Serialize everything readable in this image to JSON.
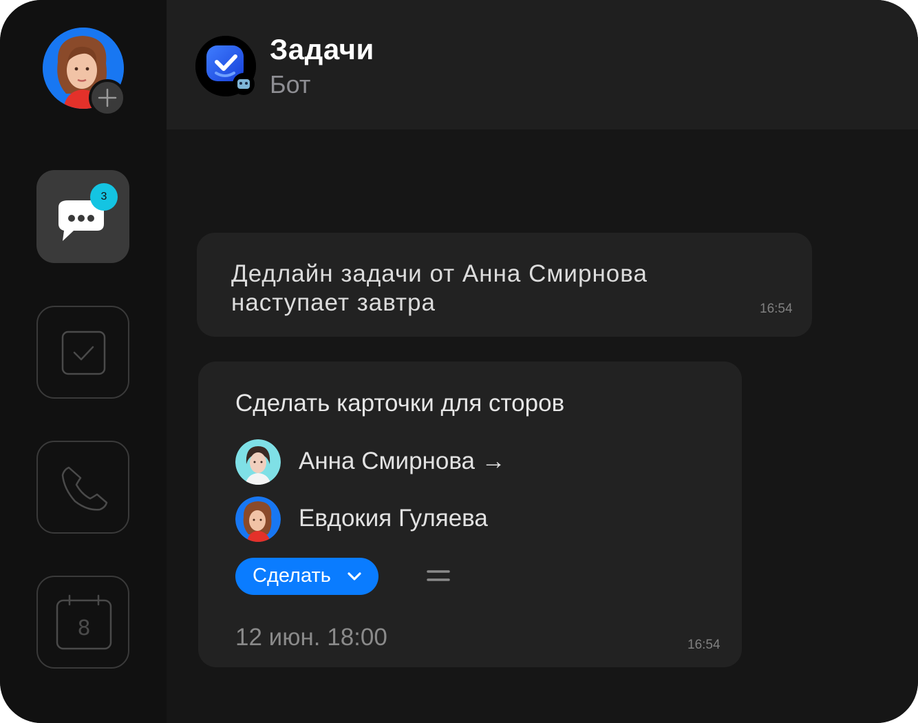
{
  "chat": {
    "title": "Задачи",
    "subtitle": "Бот"
  },
  "sidebar": {
    "unread_count": "3",
    "calendar_day": "8",
    "items": [
      {
        "name": "messages",
        "icon": "chat-bubble-icon",
        "active": true
      },
      {
        "name": "tasks",
        "icon": "checkbox-icon",
        "active": false
      },
      {
        "name": "calls",
        "icon": "phone-icon",
        "active": false
      },
      {
        "name": "calendar",
        "icon": "calendar-icon",
        "active": false
      }
    ]
  },
  "messages": [
    {
      "text_line1": "Дедлайн задачи от Анна Смирнова",
      "text_line2": "наступает завтра",
      "time": "16:54"
    }
  ],
  "task_card": {
    "title": "Сделать карточки для сторов",
    "assigner": "Анна Смирнова →",
    "assignee": "Евдокия Гуляева",
    "action_label": "Сделать",
    "due": "12 июн. 18:00",
    "time": "16:54"
  },
  "colors": {
    "accent": "#0a7cff",
    "badge": "#14c4e2",
    "background": "#141414"
  }
}
